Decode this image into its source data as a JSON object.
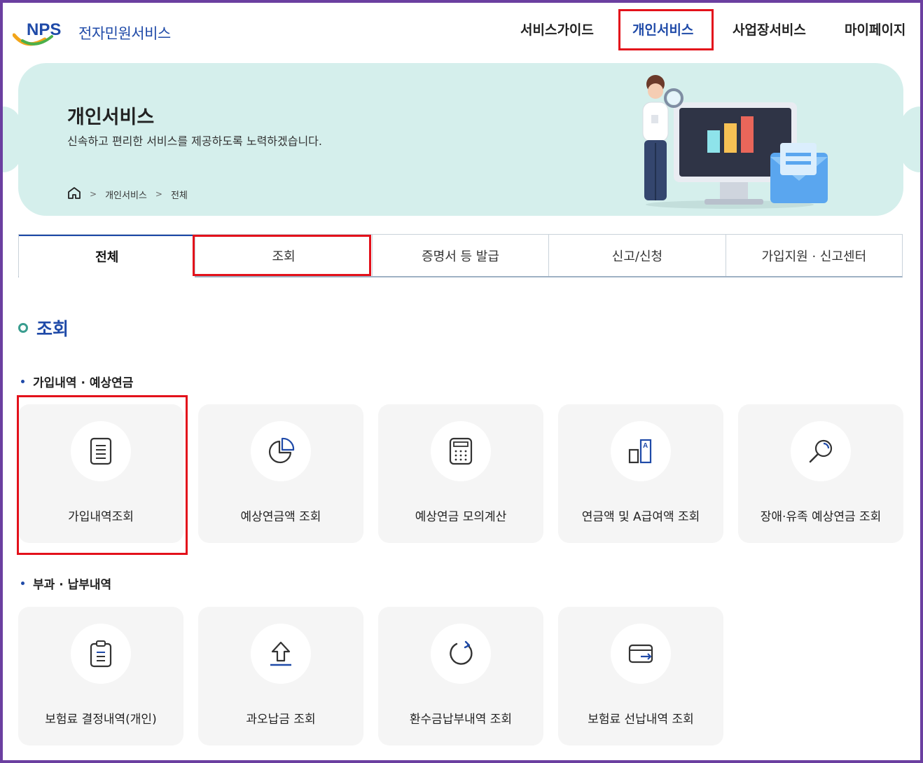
{
  "header": {
    "logo_mark": "NPS",
    "logo_text": "전자민원서비스",
    "nav": [
      {
        "label": "서비스가이드",
        "active": false
      },
      {
        "label": "개인서비스",
        "active": true
      },
      {
        "label": "사업장서비스",
        "active": false
      },
      {
        "label": "마이페이지",
        "active": false
      }
    ]
  },
  "banner": {
    "title": "개인서비스",
    "description": "신속하고 편리한 서비스를 제공하도록 노력하겠습니다.",
    "breadcrumb": [
      "개인서비스",
      "전체"
    ]
  },
  "tabs": [
    {
      "label": "전체",
      "active": true
    },
    {
      "label": "조회",
      "active": false
    },
    {
      "label": "증명서 등 발급",
      "active": false
    },
    {
      "label": "신고/신청",
      "active": false
    },
    {
      "label": "가입지원 · 신고센터",
      "active": false
    }
  ],
  "section": {
    "title": "조회",
    "groups": [
      {
        "title": "가입내역 · 예상연금",
        "items": [
          {
            "label": "가입내역조회",
            "icon": "document-icon"
          },
          {
            "label": "예상연금액 조회",
            "icon": "pie-chart-icon"
          },
          {
            "label": "예상연금 모의계산",
            "icon": "calculator-icon"
          },
          {
            "label": "연금액 및 A급여액 조회",
            "icon": "bar-a-icon"
          },
          {
            "label": "장애·유족 예상연금 조회",
            "icon": "magnifier-icon"
          }
        ]
      },
      {
        "title": "부과 · 납부내역",
        "items": [
          {
            "label": "보험료 결정내역(개인)",
            "icon": "clipboard-icon"
          },
          {
            "label": "과오납금 조회",
            "icon": "upload-arrow-icon"
          },
          {
            "label": "환수금납부내역 조회",
            "icon": "refresh-icon"
          },
          {
            "label": "보험료 선납내역 조회",
            "icon": "wallet-icon"
          }
        ]
      }
    ]
  },
  "colors": {
    "brand_blue": "#1f4aa8",
    "banner_bg": "#d5efec",
    "highlight_red": "#e3111b",
    "card_bg": "#f5f5f5",
    "accent_green": "#3a9d8f"
  }
}
